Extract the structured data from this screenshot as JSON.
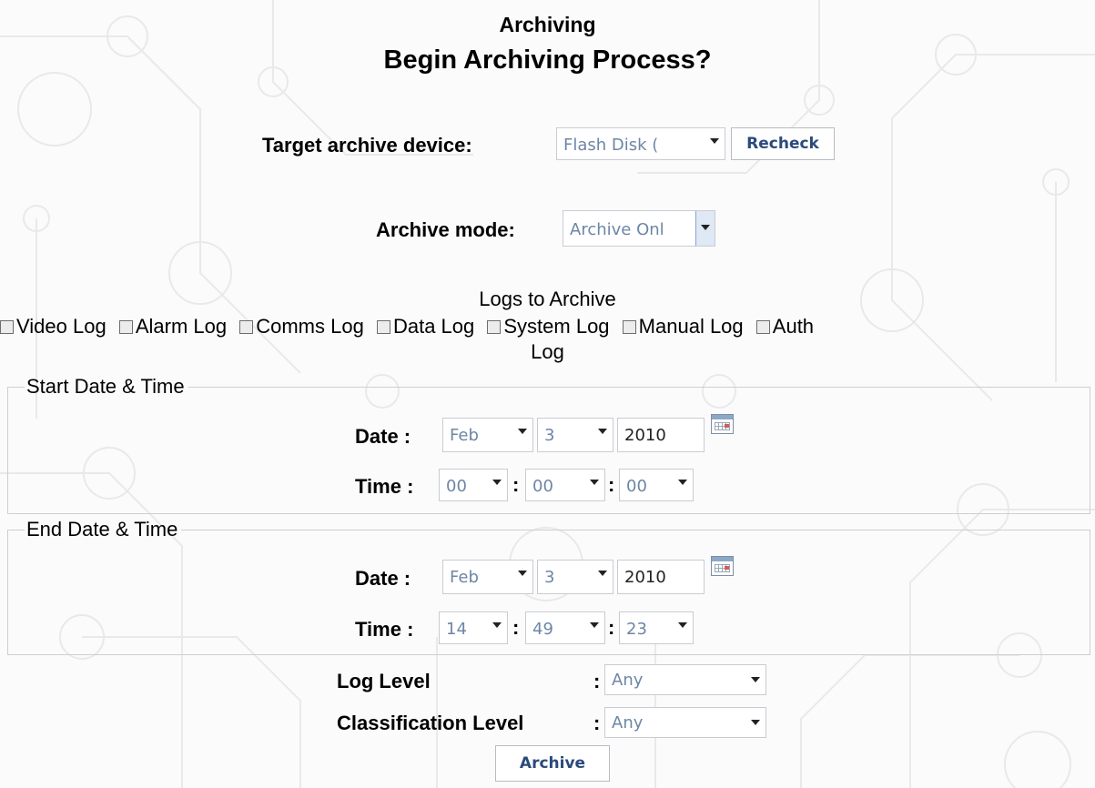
{
  "header": {
    "subtitle": "Archiving",
    "title": "Begin Archiving Process?"
  },
  "target": {
    "label": "Target archive device:",
    "value": "Flash Disk (",
    "recheck_label": "Recheck"
  },
  "mode": {
    "label": "Archive mode:",
    "value": "Archive Onl"
  },
  "logs": {
    "title": "Logs to Archive",
    "items": [
      "Video Log",
      "Alarm Log",
      "Comms Log",
      "Data Log",
      "System Log",
      "Manual Log",
      "Auth"
    ],
    "wrap_text": "Log"
  },
  "start": {
    "legend": "Start Date & Time",
    "date_label": "Date :",
    "month": "Feb",
    "day": "3",
    "year": "2010",
    "time_label": "Time :",
    "hour": "00",
    "minute": "00",
    "second": "00"
  },
  "end": {
    "legend": "End Date & Time",
    "date_label": "Date :",
    "month": "Feb",
    "day": "3",
    "year": "2010",
    "time_label": "Time :",
    "hour": "14",
    "minute": "49",
    "second": "23"
  },
  "levels": {
    "log_label": "Log Level",
    "log_value": "Any",
    "class_label": "Classification Level",
    "class_value": "Any",
    "sep": ":"
  },
  "archive_label": "Archive",
  "time_sep": ":",
  "icons": {
    "dropdown": "chevron-down-icon",
    "calendar": "calendar-icon",
    "checkbox": "checkbox-unchecked"
  }
}
